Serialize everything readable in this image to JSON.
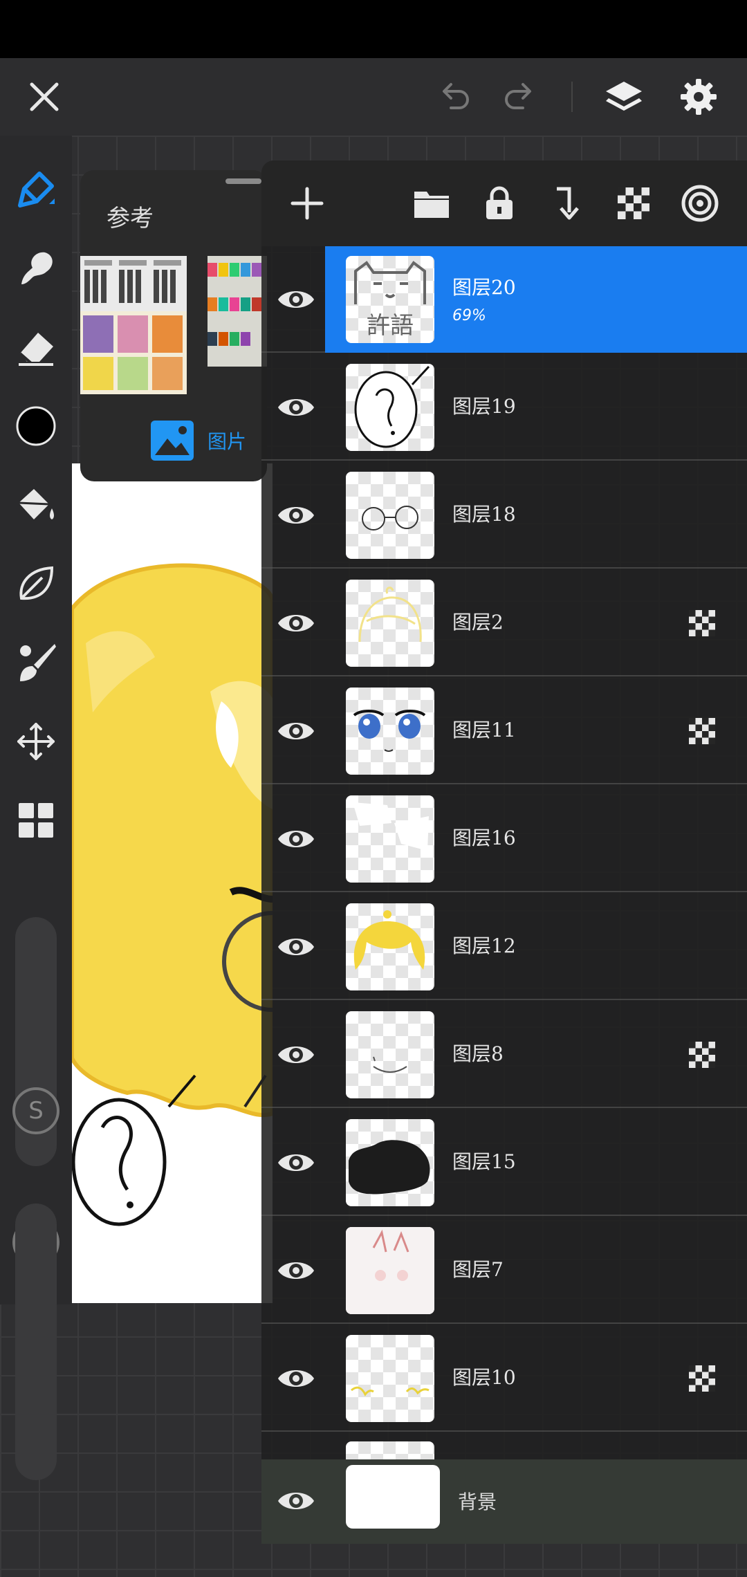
{
  "app": {
    "top_bar": {
      "close": "close-icon",
      "undo": "undo-icon",
      "redo": "redo-icon",
      "layers": "layers-icon",
      "settings": "gear-icon"
    },
    "tools": [
      "pen-icon",
      "smudge-icon",
      "eraser-icon",
      "color-swatch",
      "fill-bucket-icon",
      "leaf-icon",
      "brush-icon",
      "move-icon",
      "grid-icon"
    ],
    "current_color": "#000000",
    "accent_color": "#1a7df0",
    "slider_labels": {
      "size": "S",
      "opacity": "0"
    }
  },
  "reference": {
    "title": "参考",
    "footer_label": "图片"
  },
  "layer_toolbar": [
    "add-layer-icon",
    "folder-icon",
    "lock-icon",
    "merge-down-icon",
    "alpha-lock-icon",
    "blend-mode-icon"
  ],
  "layers": [
    {
      "name": "图层20",
      "opacity": "69%",
      "selected": true,
      "alpha_lock": false
    },
    {
      "name": "图层19",
      "alpha_lock": false
    },
    {
      "name": "图层18",
      "alpha_lock": false
    },
    {
      "name": "图层2",
      "alpha_lock": true
    },
    {
      "name": "图层11",
      "alpha_lock": true
    },
    {
      "name": "图层16",
      "alpha_lock": false
    },
    {
      "name": "图层12",
      "alpha_lock": false
    },
    {
      "name": "图层8",
      "alpha_lock": true
    },
    {
      "name": "图层15",
      "alpha_lock": false
    },
    {
      "name": "图层7",
      "alpha_lock": false
    },
    {
      "name": "图层10",
      "alpha_lock": true
    }
  ],
  "background_layer": {
    "name": "背景"
  }
}
